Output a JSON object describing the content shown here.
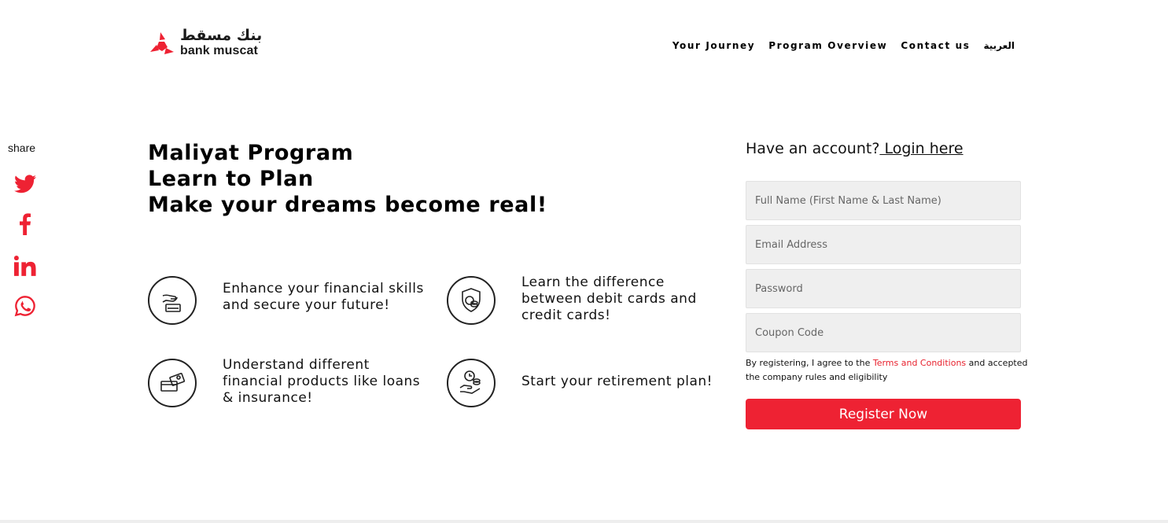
{
  "brand": {
    "name_ar": "بنك مسقط",
    "name_en": "bank muscat",
    "accent": "#ee2233"
  },
  "nav": {
    "items": [
      "Your Journey",
      "Program Overview",
      "Contact us",
      "العربية"
    ]
  },
  "share": {
    "label": "share",
    "icons": [
      "twitter-icon",
      "facebook-icon",
      "linkedin-icon",
      "whatsapp-icon"
    ]
  },
  "hero": {
    "line1": "Maliyat Program",
    "line2": "Learn to Plan",
    "line3": "Make your dreams become real!"
  },
  "features": [
    {
      "icon": "hand-card-icon",
      "text": "Enhance your financial skills and secure your future!"
    },
    {
      "icon": "shield-coins-icon",
      "text": "Learn the difference between debit cards and credit cards!"
    },
    {
      "icon": "cards-bills-icon",
      "text": "Understand different financial products like loans & insurance!"
    },
    {
      "icon": "clock-hand-coins-icon",
      "text": "Start your retirement plan!"
    }
  ],
  "form": {
    "have_account": "Have an account?",
    "login_link": " Login here",
    "fields": [
      {
        "placeholder": "Full Name (First Name & Last Name)",
        "value": ""
      },
      {
        "placeholder": "Email Address",
        "value": ""
      },
      {
        "placeholder": "Password",
        "value": ""
      },
      {
        "placeholder": "Coupon Code",
        "value": ""
      }
    ],
    "terms_prefix": "By registering, I agree to the ",
    "terms_link": "Terms and Conditions",
    "terms_suffix": " and accepted the company rules and eligibility",
    "submit_label": "Register Now"
  }
}
